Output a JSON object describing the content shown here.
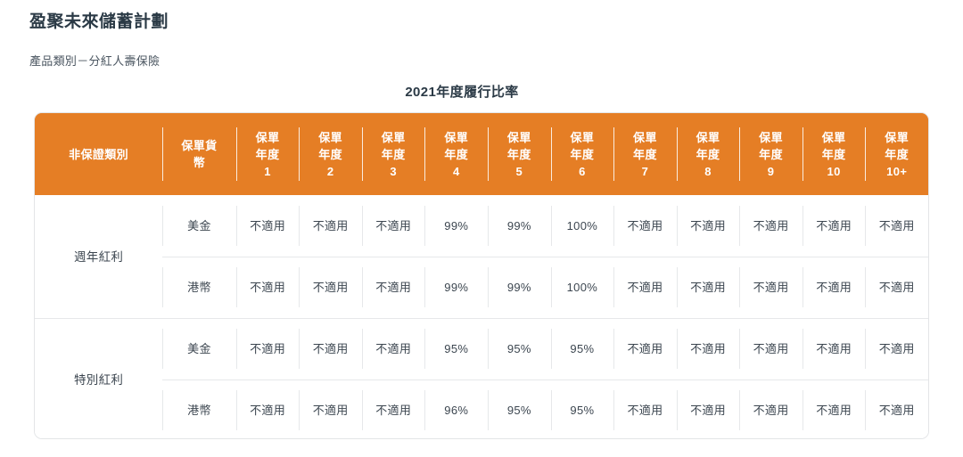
{
  "page": {
    "title": "盈聚未來儲蓄計劃",
    "subtitle": "產品類別－分紅人壽保險",
    "section_heading": "2021年度履行比率"
  },
  "theme": {
    "header_orange": "#e57e25",
    "text_dark": "#2b3a46",
    "text_body": "#3c4650",
    "rule_gray": "#e6e8ea",
    "card_border": "#e3e5e7"
  },
  "table": {
    "headers": [
      {
        "key": "category",
        "lines": [
          "非保證類別"
        ]
      },
      {
        "key": "currency",
        "lines": [
          "保單貨",
          "幣"
        ]
      },
      {
        "key": "y1",
        "lines": [
          "保單",
          "年度",
          "1"
        ]
      },
      {
        "key": "y2",
        "lines": [
          "保單",
          "年度",
          "2"
        ]
      },
      {
        "key": "y3",
        "lines": [
          "保單",
          "年度",
          "3"
        ]
      },
      {
        "key": "y4",
        "lines": [
          "保單",
          "年度",
          "4"
        ]
      },
      {
        "key": "y5",
        "lines": [
          "保單",
          "年度",
          "5"
        ]
      },
      {
        "key": "y6",
        "lines": [
          "保單",
          "年度",
          "6"
        ]
      },
      {
        "key": "y7",
        "lines": [
          "保單",
          "年度",
          "7"
        ]
      },
      {
        "key": "y8",
        "lines": [
          "保單",
          "年度",
          "8"
        ]
      },
      {
        "key": "y9",
        "lines": [
          "保單",
          "年度",
          "9"
        ]
      },
      {
        "key": "y10",
        "lines": [
          "保單",
          "年度",
          "10"
        ]
      },
      {
        "key": "y10p",
        "lines": [
          "保單",
          "年度",
          "10+"
        ]
      }
    ],
    "na_label": "不適用",
    "groups": [
      {
        "category": "週年紅利",
        "rows": [
          {
            "currency": "美金",
            "values": [
              "不適用",
              "不適用",
              "不適用",
              "99%",
              "99%",
              "100%",
              "不適用",
              "不適用",
              "不適用",
              "不適用",
              "不適用"
            ]
          },
          {
            "currency": "港幣",
            "values": [
              "不適用",
              "不適用",
              "不適用",
              "99%",
              "99%",
              "100%",
              "不適用",
              "不適用",
              "不適用",
              "不適用",
              "不適用"
            ]
          }
        ]
      },
      {
        "category": "特別紅利",
        "rows": [
          {
            "currency": "美金",
            "values": [
              "不適用",
              "不適用",
              "不適用",
              "95%",
              "95%",
              "95%",
              "不適用",
              "不適用",
              "不適用",
              "不適用",
              "不適用"
            ]
          },
          {
            "currency": "港幣",
            "values": [
              "不適用",
              "不適用",
              "不適用",
              "96%",
              "95%",
              "95%",
              "不適用",
              "不適用",
              "不適用",
              "不適用",
              "不適用"
            ]
          }
        ]
      }
    ]
  }
}
